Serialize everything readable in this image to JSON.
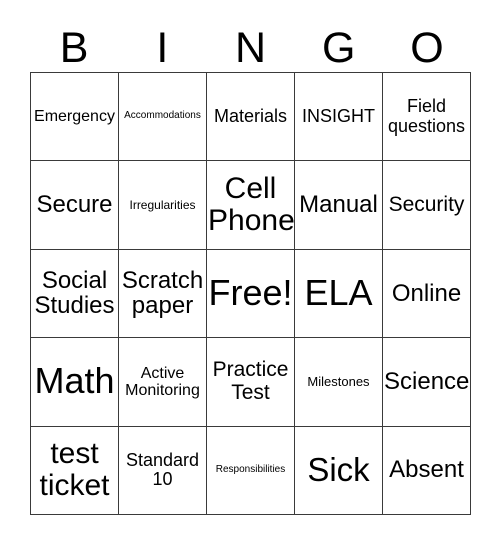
{
  "card": {
    "title": "BINGO",
    "header_letters": [
      "B",
      "I",
      "N",
      "G",
      "O"
    ],
    "columns": 5,
    "rows": 5,
    "border_color": "#3a3a3a",
    "background_color": "#ffffff",
    "text_color": "#000000",
    "free_space": "Free!",
    "cells": [
      [
        {
          "label": "Emergency",
          "size": "m"
        },
        {
          "label": "Accommodations",
          "size": "xs"
        },
        {
          "label": "Materials",
          "size": "ml"
        },
        {
          "label": "INSIGHT",
          "size": "ml"
        },
        {
          "label": "Field questions",
          "size": "ml"
        }
      ],
      [
        {
          "label": "Secure",
          "size": "xl"
        },
        {
          "label": "Irregularities",
          "size": "s"
        },
        {
          "label": "Cell Phone",
          "size": "xxl"
        },
        {
          "label": "Manual",
          "size": "xl"
        },
        {
          "label": "Security",
          "size": "l"
        }
      ],
      [
        {
          "label": "Social Studies",
          "size": "xl"
        },
        {
          "label": "Scratch paper",
          "size": "xl"
        },
        {
          "label": "Free!",
          "size": "4xl"
        },
        {
          "label": "ELA",
          "size": "4xl"
        },
        {
          "label": "Online",
          "size": "xl"
        }
      ],
      [
        {
          "label": "Math",
          "size": "4xl"
        },
        {
          "label": "Active Monitoring",
          "size": "m"
        },
        {
          "label": "Practice Test",
          "size": "l"
        },
        {
          "label": "Milestones",
          "size": "sm"
        },
        {
          "label": "Science",
          "size": "xl"
        }
      ],
      [
        {
          "label": "test ticket",
          "size": "xxl"
        },
        {
          "label": "Standard 10",
          "size": "ml"
        },
        {
          "label": "Responsibilities",
          "size": "xs"
        },
        {
          "label": "Sick",
          "size": "3xl"
        },
        {
          "label": "Absent",
          "size": "xl"
        }
      ]
    ]
  }
}
